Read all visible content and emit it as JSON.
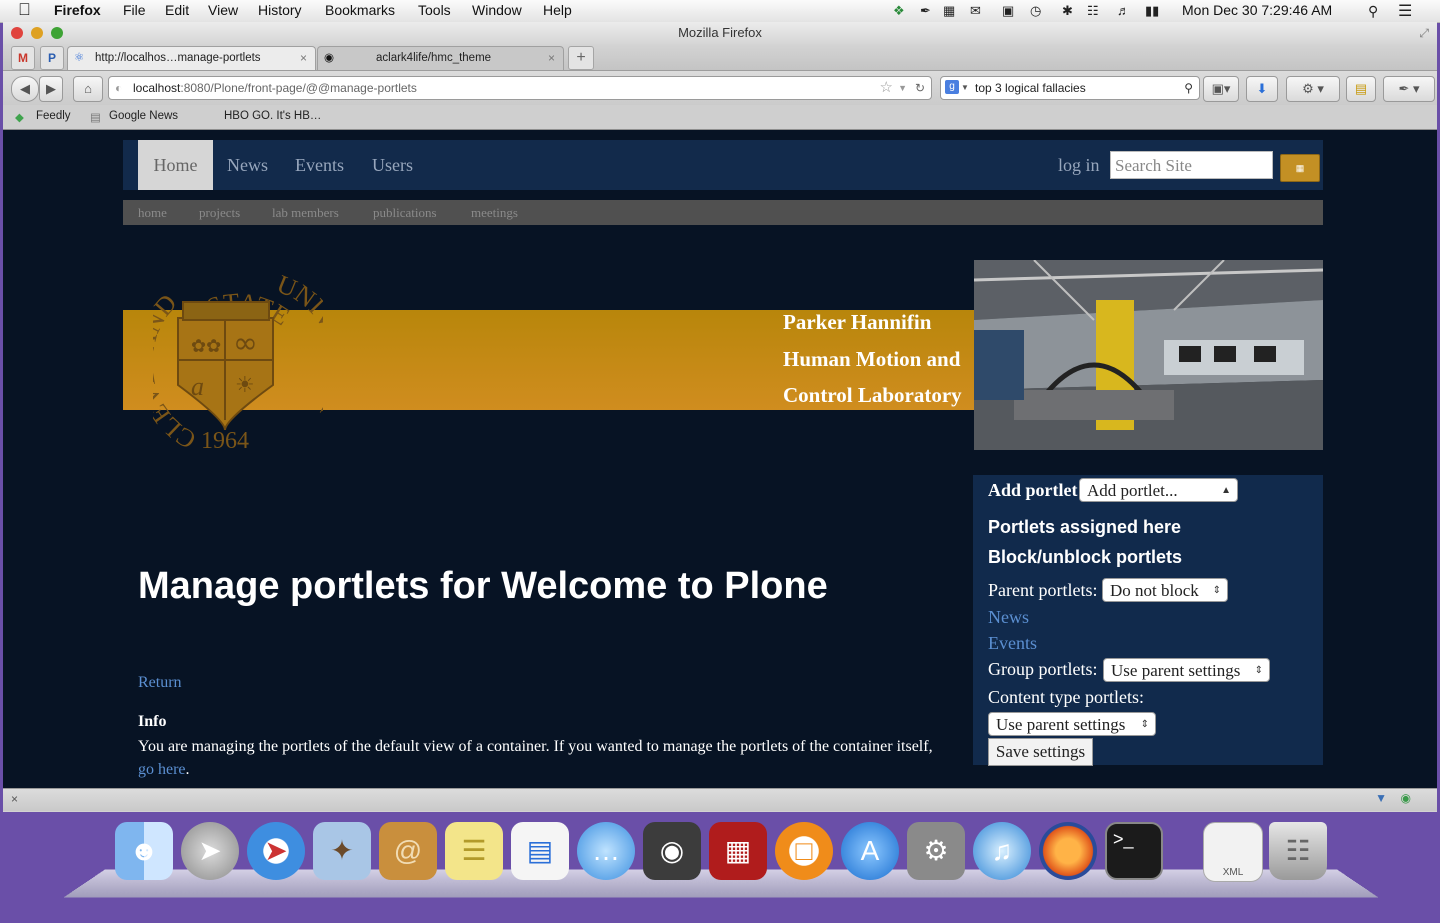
{
  "menubar": {
    "app_name": "Firefox",
    "menus": [
      "File",
      "Edit",
      "View",
      "History",
      "Bookmarks",
      "Tools",
      "Window",
      "Help"
    ],
    "clock": "Mon Dec 30  7:29:46 AM"
  },
  "window": {
    "title": "Mozilla Firefox"
  },
  "tabs": [
    {
      "label": "http://localhos…manage-portlets",
      "active": true
    },
    {
      "label": "aclark4life/hmc_theme",
      "active": false
    }
  ],
  "toolbar": {
    "url_host": "localhost",
    "url_rest": ":8080/Plone/front-page/@@manage-portlets",
    "search_value": "top 3 logical fallacies"
  },
  "bookmarks": [
    "Feedly",
    "Google News",
    "HBO GO. It's HB…"
  ],
  "site": {
    "nav": [
      "Home",
      "News",
      "Events",
      "Users"
    ],
    "login": "log in",
    "search_placeholder": "Search Site",
    "subnav": [
      "home",
      "projects",
      "lab members",
      "publications",
      "meetings"
    ],
    "lab_name": [
      "Parker Hannifin",
      "Human Motion and",
      "Control Laboratory"
    ],
    "seal": {
      "top": "STATE",
      "left": "CLEVELAND",
      "right": "UNIVERSITY",
      "year": "1964",
      "letter": "a"
    }
  },
  "portlets": {
    "add_label": "Add portlet",
    "add_select": "Add portlet...",
    "assigned_heading": "Portlets assigned here",
    "block_heading": "Block/unblock portlets",
    "parent_label": "Parent portlets:",
    "parent_select": "Do not block",
    "links": [
      "News",
      "Events"
    ],
    "group_label": "Group portlets:",
    "group_select": "Use parent settings",
    "content_type_label": "Content type portlets:",
    "content_type_select": "Use parent settings",
    "save_label": "Save settings"
  },
  "main": {
    "title": "Manage portlets for Welcome to Plone",
    "return_link": "Return",
    "info_heading": "Info",
    "info_text": "You are managing the portlets of the default view of a container. If you wanted to manage the portlets of the container itself, ",
    "info_link": "go here",
    "info_end": "."
  },
  "dock": {
    "items": [
      "finder-icon",
      "launchpad-icon",
      "safari-icon",
      "mail-icon",
      "contacts-icon",
      "notes-icon",
      "calendar-icon",
      "messages-icon",
      "facetime-icon",
      "photo-booth-icon",
      "ibooks-icon",
      "app-store-icon",
      "system-preferences-icon",
      "itunes-icon",
      "firefox-icon",
      "terminal-icon",
      "xml-file-icon",
      "trash-icon"
    ],
    "xml_label": "XML"
  },
  "colors": {
    "page_bg": "#071324",
    "nav_bg": "#122a4b",
    "gold": "#c39024",
    "link": "#5b8fd1"
  }
}
